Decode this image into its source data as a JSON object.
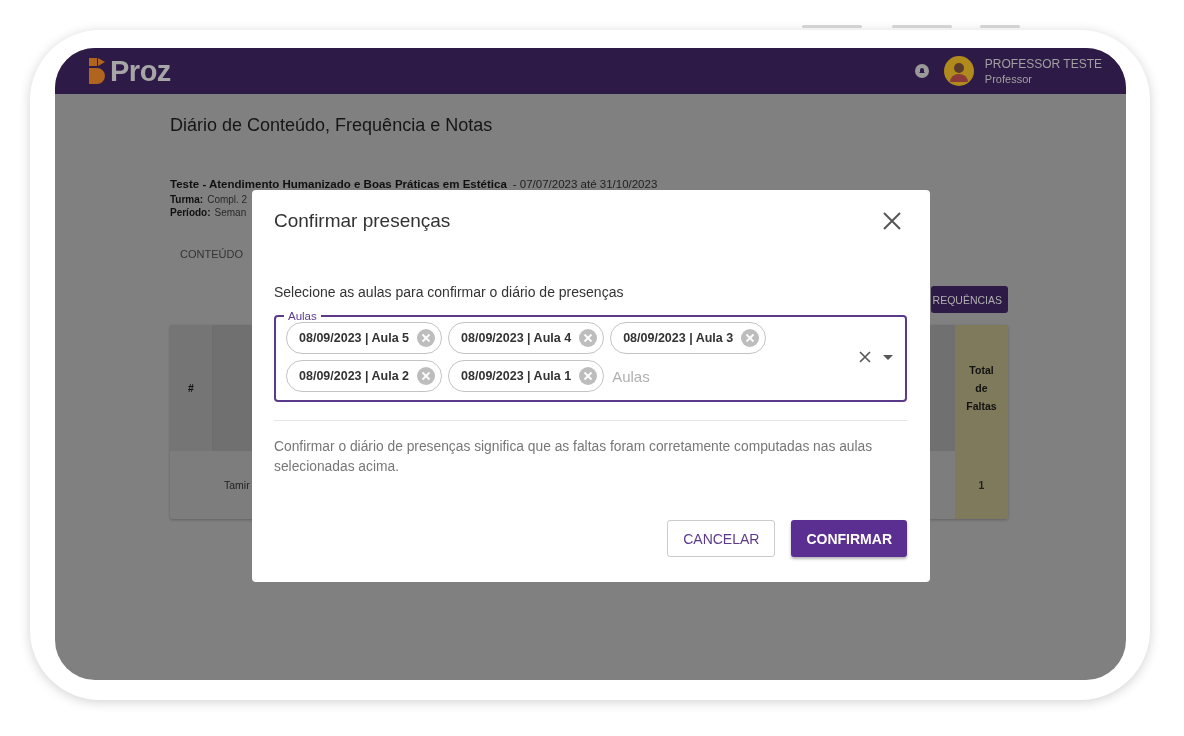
{
  "app_bar": {
    "logo": "Proz",
    "user_name": "PROFESSOR TESTE",
    "user_role": "Professor"
  },
  "page": {
    "title": "Diário de Conteúdo, Frequência e Notas",
    "course": "Teste - Atendimento Humanizado e Boas Práticas em Estética",
    "dates": "- 07/07/2023 até 31/10/2023",
    "details": [
      {
        "label": "Turma:",
        "value": "Compl. 2"
      },
      {
        "label": "Período:",
        "value": "Seman"
      }
    ],
    "tabs": [
      "CONTEÚDO"
    ],
    "action_button": "REQUÊNCIAS",
    "table": {
      "columns": [
        "#",
        "Total de Faltas"
      ],
      "rows": [
        {
          "name": "Tamir",
          "total": "1"
        }
      ]
    }
  },
  "dialog": {
    "title": "Confirmar presenças",
    "prompt": "Selecione as aulas para confirmar o diário de presenças",
    "field": {
      "label": "Aulas",
      "placeholder": "Aulas",
      "chips": [
        "08/09/2023 | Aula 5",
        "08/09/2023 | Aula 4",
        "08/09/2023 | Aula 3",
        "08/09/2023 | Aula 2",
        "08/09/2023 | Aula 1"
      ]
    },
    "note": "Confirmar o diário de presenças significa que as faltas foram corretamente computadas nas aulas selecionadas acima.",
    "buttons": [
      {
        "label": "CANCELAR",
        "kind": "outlined"
      },
      {
        "label": "CONFIRMAR",
        "kind": "primary"
      }
    ]
  }
}
